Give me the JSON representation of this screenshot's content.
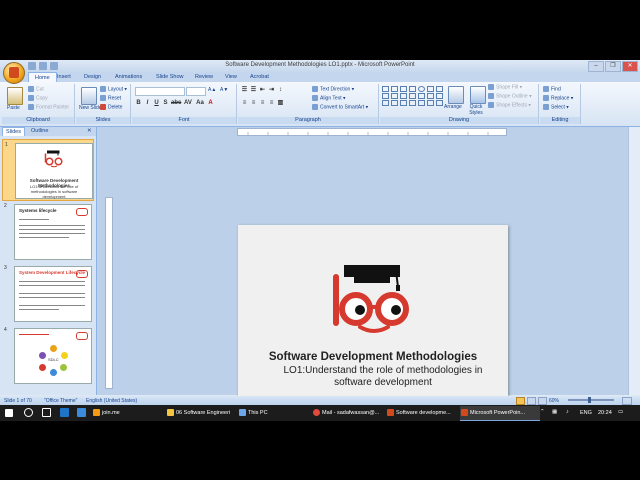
{
  "window": {
    "title": "Software Development Methodologies LO1.pptx - Microsoft PowerPoint",
    "controls": [
      "–",
      "❐",
      "✕"
    ]
  },
  "ribbon_tabs": [
    "Home",
    "Insert",
    "Design",
    "Animations",
    "Slide Show",
    "Review",
    "View",
    "Acrobat"
  ],
  "ribbon": {
    "clipboard": {
      "label": "Clipboard",
      "paste": "Paste",
      "cut": "Cut",
      "copy": "Copy",
      "format_painter": "Format Painter"
    },
    "slides": {
      "label": "Slides",
      "new_slide": "New Slide ▾",
      "layout": "Layout ▾",
      "reset": "Reset",
      "delete": "Delete"
    },
    "font": {
      "label": "Font",
      "buttons": [
        "B",
        "I",
        "U",
        "S",
        "abc",
        "AV",
        "Aa",
        "A"
      ]
    },
    "paragraph": {
      "label": "Paragraph",
      "text_direction": "Text Direction ▾",
      "align_text": "Align Text ▾",
      "convert_smartart": "Convert to SmartArt ▾"
    },
    "drawing": {
      "label": "Drawing",
      "arrange": "Arrange",
      "quick_styles": "Quick Styles",
      "shape_fill": "Shape Fill ▾",
      "shape_outline": "Shape Outline ▾",
      "shape_effects": "Shape Effects ▾"
    },
    "editing": {
      "label": "Editing",
      "find": "Find",
      "replace": "Replace ▾",
      "select": "Select ▾"
    }
  },
  "panel": {
    "tabs": [
      "Slides",
      "Outline"
    ],
    "thumbnails": [
      {
        "num": "1",
        "title": "Software Development Methodologies",
        "subtitle": "LO1:Understand the role of methodologies in software development"
      },
      {
        "num": "2",
        "title": "Systems lifecycle"
      },
      {
        "num": "3",
        "title": "System Development Lifecycle"
      },
      {
        "num": "4",
        "title": "",
        "label": "SDLC"
      }
    ]
  },
  "slide": {
    "title": "Software Development Methodologies",
    "subtitle": "LO1:Understand the role of methodologies in software development",
    "number": "1"
  },
  "statusbar": {
    "slide_info": "Slide 1 of 70",
    "theme": "\"Office Theme\"",
    "language": "English (United States)",
    "zoom": "60%"
  },
  "taskbar": {
    "items": [
      "join.me",
      "06 Software Engineeri",
      "This PC",
      "Mail - sadafwassan@...",
      "Software developme...",
      "Microsoft PowerPoin..."
    ],
    "lang": "ENG",
    "time": "20:24"
  },
  "colors": {
    "accent": "#d63a2f",
    "ribbon_text": "#15428b"
  }
}
